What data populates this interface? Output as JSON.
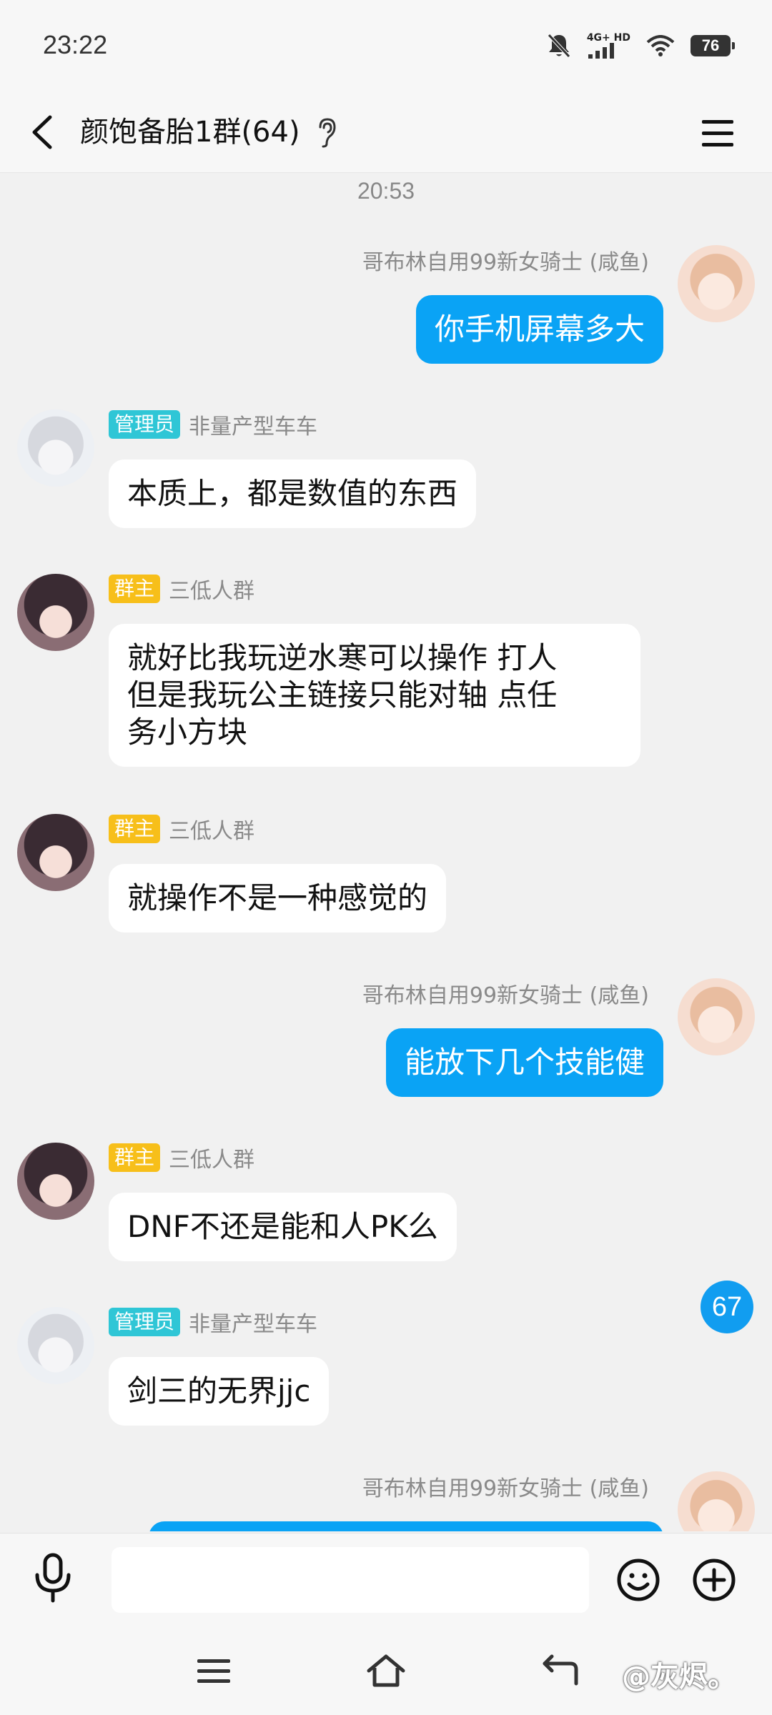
{
  "status_bar": {
    "time": "23:22",
    "network_label": "4G+ HD",
    "battery": "76",
    "icons": [
      "mute-icon",
      "signal-icon",
      "wifi-icon",
      "battery-icon"
    ]
  },
  "header": {
    "title": "颜饱备胎1群(64)",
    "icons": [
      "back-arrow-icon",
      "ear-icon",
      "menu-icon"
    ]
  },
  "chat": {
    "timestamp": "20:53",
    "messages": [
      {
        "sender": "哥布林自用99新女骑士 (咸鱼)",
        "badge": "",
        "text": "你手机屏幕多大",
        "mine": true
      },
      {
        "sender": "非量产型车车",
        "badge": "管理员",
        "text": "本质上，都是数值的东西",
        "mine": false
      },
      {
        "sender": "三低人群",
        "badge": "群主",
        "text": "就好比我玩逆水寒可以操作 打人\n但是我玩公主链接只能对轴 点任\n务小方块",
        "mine": false
      },
      {
        "sender": "三低人群",
        "badge": "群主",
        "text": "就操作不是一种感觉的",
        "mine": false
      },
      {
        "sender": "哥布林自用99新女骑士 (咸鱼)",
        "badge": "",
        "text": "能放下几个技能健",
        "mine": true
      },
      {
        "sender": "三低人群",
        "badge": "群主",
        "text": "DNF不还是能和人PK么",
        "mine": false
      },
      {
        "sender": "非量产型车车",
        "badge": "管理员",
        "text": "剑三的无界jjc",
        "mine": false
      },
      {
        "sender": "哥布林自用99新女骑士 (咸鱼)",
        "badge": "",
        "text": "",
        "mine": true
      }
    ],
    "unread_count": "67"
  },
  "input_bar": {
    "placeholder": "",
    "icons": [
      "microphone-icon",
      "emoji-icon",
      "plus-icon"
    ]
  },
  "nav_bar": {
    "icons": [
      "menu-nav-icon",
      "home-icon",
      "back-nav-icon"
    ],
    "watermark": "@灰烬。"
  },
  "colors": {
    "my_bubble": "#0aa3f5",
    "admin_badge": "#2fc6d6",
    "owner_badge": "#f7bf1a",
    "unread_badge": "#119df0"
  }
}
